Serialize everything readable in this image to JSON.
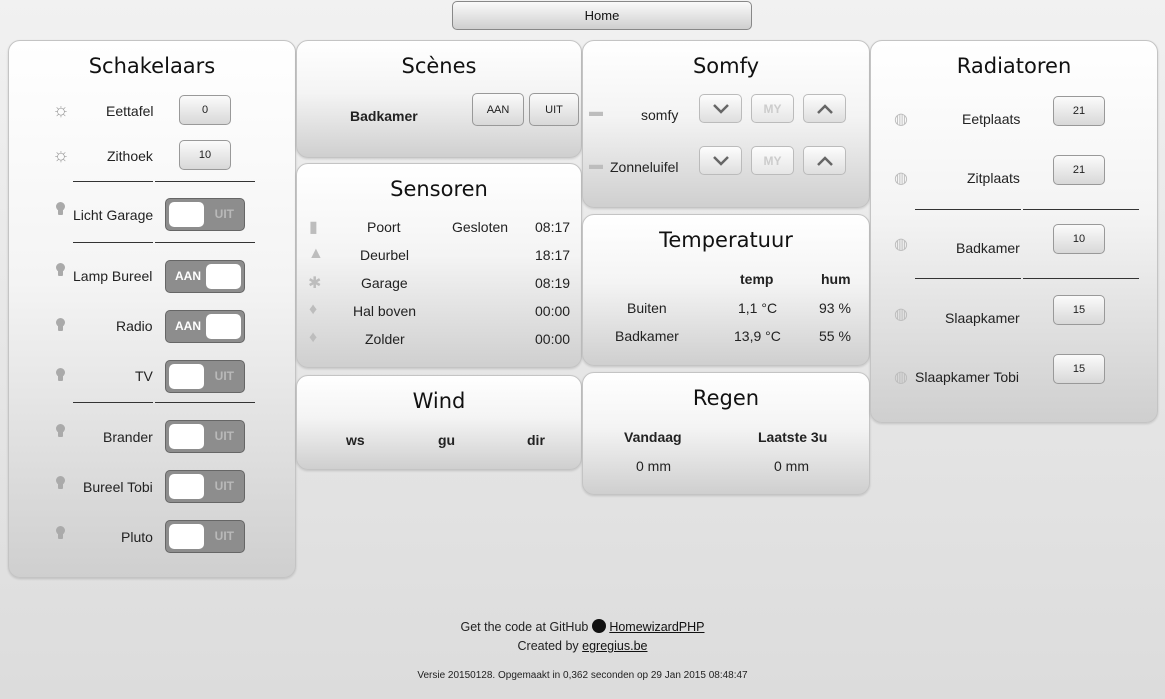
{
  "home_label": "Home",
  "schakelaars": {
    "title": "Schakelaars",
    "dimmers": [
      {
        "label": "Eettafel",
        "value": "0"
      },
      {
        "label": "Zithoek",
        "value": "10"
      }
    ],
    "switches": [
      {
        "label": "Licht Garage",
        "state": "UIT"
      },
      {
        "label": "Lamp Bureel",
        "state": "AAN"
      },
      {
        "label": "Radio",
        "state": "AAN"
      },
      {
        "label": "TV",
        "state": "UIT"
      },
      {
        "label": "Brander",
        "state": "UIT"
      },
      {
        "label": "Bureel Tobi",
        "state": "UIT"
      },
      {
        "label": "Pluto",
        "state": "UIT"
      }
    ]
  },
  "scenes": {
    "title": "Scènes",
    "items": [
      {
        "label": "Badkamer",
        "on_label": "AAN",
        "off_label": "UIT"
      }
    ]
  },
  "somfy": {
    "title": "Somfy",
    "items": [
      {
        "label": "somfy",
        "my_label": "MY"
      },
      {
        "label": "Zonneluifel",
        "my_label": "MY"
      }
    ]
  },
  "radiatoren": {
    "title": "Radiatoren",
    "items": [
      {
        "label": "Eetplaats",
        "value": "21"
      },
      {
        "label": "Zitplaats",
        "value": "21"
      },
      {
        "label": "Badkamer",
        "value": "10"
      },
      {
        "label": "Slaapkamer",
        "value": "15"
      },
      {
        "label": "Slaapkamer Tobi",
        "value": "15"
      }
    ]
  },
  "sensoren": {
    "title": "Sensoren",
    "rows": [
      {
        "icon": "door-icon",
        "name": "Poort",
        "status": "Gesloten",
        "time": "08:17"
      },
      {
        "icon": "bell-icon",
        "name": "Deurbel",
        "status": "",
        "time": "18:17"
      },
      {
        "icon": "motion-icon",
        "name": "Garage",
        "status": "",
        "time": "08:19"
      },
      {
        "icon": "flame-icon",
        "name": "Hal boven",
        "status": "",
        "time": "00:00"
      },
      {
        "icon": "flame-icon",
        "name": "Zolder",
        "status": "",
        "time": "00:00"
      }
    ]
  },
  "temperatuur": {
    "title": "Temperatuur",
    "headers": [
      "temp",
      "hum"
    ],
    "rows": [
      {
        "name": "Buiten",
        "temp": "1,1 °C",
        "hum": "93 %"
      },
      {
        "name": "Badkamer",
        "temp": "13,9 °C",
        "hum": "55 %"
      }
    ]
  },
  "wind": {
    "title": "Wind",
    "headers": [
      "ws",
      "gu",
      "dir"
    ]
  },
  "regen": {
    "title": "Regen",
    "headers": [
      "Vandaag",
      "Laatste 3u"
    ],
    "values": [
      "0 mm",
      "0 mm"
    ]
  },
  "footer": {
    "github_prefix": "Get the code at GitHub",
    "github_link": "HomewizardPHP",
    "created_prefix": "Created by",
    "created_link": "egregius.be",
    "version": "Versie 20150128. Opgemaakt in 0,362 seconden op 29 Jan 2015 08:48:47"
  },
  "colors": {
    "toggle_bg": "#8d8d8d",
    "panel_border": "#c4c4c4"
  }
}
